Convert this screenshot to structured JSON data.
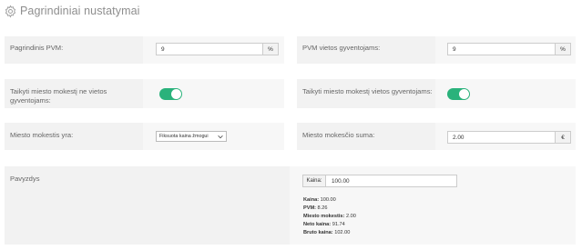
{
  "page": {
    "title": "Pagrindiniai nustatymai",
    "icon": "gear-icon"
  },
  "vat": {
    "label": "Pagrindinis PVM:",
    "value": "9",
    "unit": "%"
  },
  "vat_locals": {
    "label": "PVM vietos gyventojams:",
    "value": "9",
    "unit": "%"
  },
  "city_tax_nonlocal": {
    "label": "Taikyti miesto mokestį ne vietos gyventojams:",
    "enabled": true
  },
  "city_tax_local": {
    "label": "Taikyti miesto mokestį vietos gyventojams:",
    "enabled": true
  },
  "city_tax_type": {
    "label": "Miesto mokestis yra:",
    "selected": "Fiksuota kaina žmogui"
  },
  "city_tax_amount": {
    "label": "Miesto mokesčio suma:",
    "value": "2.00",
    "unit": "€"
  },
  "example": {
    "label": "Pavyzdys",
    "price_label": "Kaina:",
    "price_value": "100.00",
    "results": [
      {
        "key": "Kaina:",
        "value": "100.00"
      },
      {
        "key": "PVM:",
        "value": "8.26"
      },
      {
        "key": "Miesto mokestis:",
        "value": "2.00"
      },
      {
        "key": "Neto kaina:",
        "value": "91.74"
      },
      {
        "key": "Bruto kaina:",
        "value": "102.00"
      }
    ]
  },
  "colors": {
    "toggle_on": "#2ab27b",
    "panel_bg": "#f2f2f2"
  }
}
